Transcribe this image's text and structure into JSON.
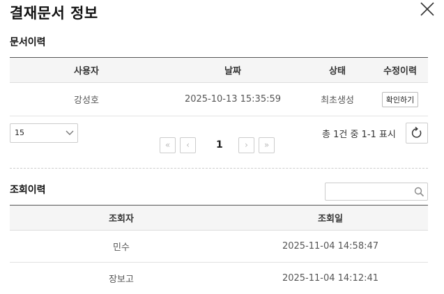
{
  "modal": {
    "title": "결재문서 정보"
  },
  "history": {
    "section_title": "문서이력",
    "columns": [
      "사용자",
      "날짜",
      "상태",
      "수정이력"
    ],
    "rows": [
      {
        "user": "강성호",
        "date": "2025-10-13 15:35:59",
        "status": "최초생성",
        "action_label": "확인하기"
      }
    ],
    "page_size": "15",
    "pagination": {
      "current_page": "1",
      "first": "«",
      "prev": "‹",
      "next": "›",
      "last": "»"
    },
    "summary": "총 1건 중 1-1 표시"
  },
  "views": {
    "section_title": "조회이력",
    "search": {
      "placeholder": ""
    },
    "columns": [
      "조회자",
      "조회일"
    ],
    "rows": [
      {
        "viewer": "민수",
        "date": "2025-11-04 14:58:47"
      },
      {
        "viewer": "장보고",
        "date": "2025-11-04 14:12:41"
      }
    ]
  },
  "icons": {
    "close": "close-icon",
    "dropdown": "chevron-down-icon",
    "refresh": "refresh-icon",
    "search": "search-icon"
  }
}
